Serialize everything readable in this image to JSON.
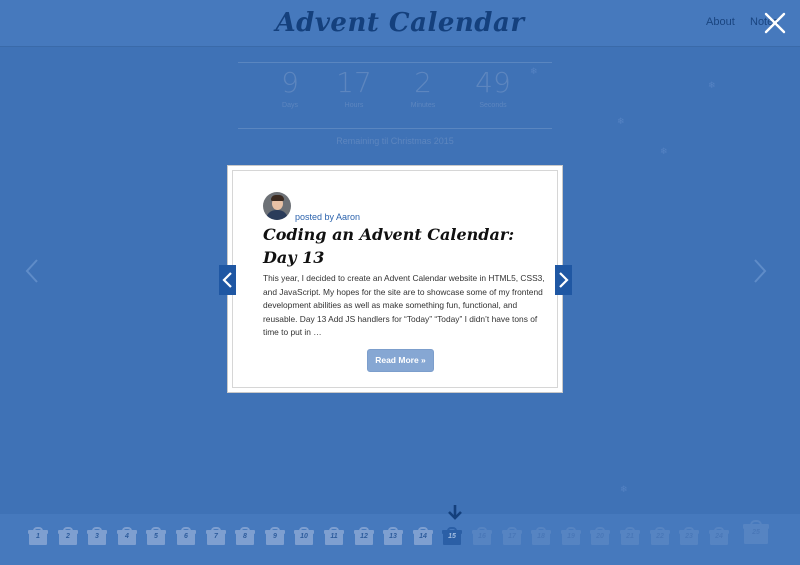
{
  "header": {
    "title": "Advent Calendar",
    "nav": [
      {
        "label": "About"
      },
      {
        "label": "Notes"
      }
    ],
    "close_icon": "close-icon"
  },
  "countdown": {
    "units": [
      {
        "value": "9",
        "label": "Days"
      },
      {
        "value": "17",
        "label": "Hours"
      },
      {
        "value": "2",
        "label": "Minutes"
      },
      {
        "value": "49",
        "label": "Seconds"
      }
    ],
    "caption": "Remaining til Christmas 2015"
  },
  "modal": {
    "author": "posted by Aaron",
    "title": "Coding an Advent Calendar: Day 13",
    "excerpt": "This year, I decided to create an Advent Calendar website in HTML5, CSS3, and JavaScript. My hopes for the site are to showcase some of my frontend development abilities as well as make something fun, functional, and reusable. Day 13 Add JS handlers for “Today” “Today” I didn’t have tons of time to put in …",
    "read_more": "Read More »",
    "prev_icon": "chevron-left-icon",
    "next_icon": "chevron-right-icon"
  },
  "gifts": {
    "days": [
      "1",
      "2",
      "3",
      "4",
      "5",
      "6",
      "7",
      "8",
      "9",
      "10",
      "11",
      "12",
      "13",
      "14",
      "15",
      "16",
      "17",
      "18",
      "19",
      "20",
      "21",
      "22",
      "23",
      "24",
      "25"
    ],
    "today": "15",
    "today_marker_icon": "arrow-down-icon"
  },
  "colors": {
    "background": "#3f72b6",
    "header": "#4679bd",
    "title": "#14407d",
    "accent": "#1f57a3",
    "button": "#86a7d3"
  }
}
